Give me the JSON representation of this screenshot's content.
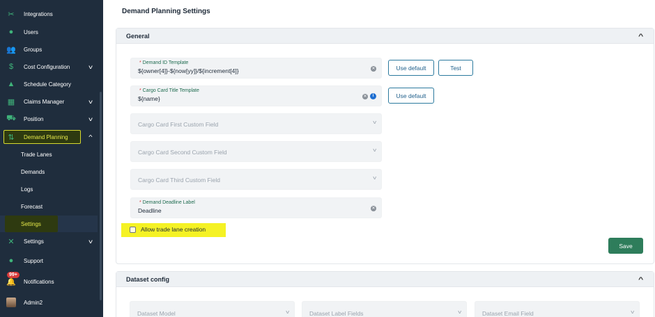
{
  "sidebar": {
    "items": [
      {
        "label": "Integrations",
        "icon": "integrations-icon"
      },
      {
        "label": "Users",
        "icon": "user-icon"
      },
      {
        "label": "Groups",
        "icon": "groups-icon"
      },
      {
        "label": "Cost Configuration",
        "icon": "dollar-icon"
      },
      {
        "label": "Schedule Category",
        "icon": "shapes-icon"
      },
      {
        "label": "Claims Manager",
        "icon": "claims-icon"
      },
      {
        "label": "Position",
        "icon": "cart-icon"
      },
      {
        "label": "Demand Planning",
        "icon": "demand-icon"
      },
      {
        "label": "Settings",
        "icon": "tools-icon"
      },
      {
        "label": "Support",
        "icon": "chat-icon"
      },
      {
        "label": "Notifications",
        "icon": "bell-icon"
      },
      {
        "label": "Admin2",
        "icon": "avatar"
      }
    ],
    "subitems": [
      "Trade Lanes",
      "Demands",
      "Logs",
      "Forecast",
      "Settings"
    ],
    "notification_badge": "99+"
  },
  "main": {
    "title": "Demand Planning Settings",
    "general": {
      "header": "General",
      "demand_id": {
        "label": "Demand ID Template",
        "value": "${owner[4]}-${now[yy]}/${increment[4]}"
      },
      "cargo_title": {
        "label": "Cargo Card Title Template",
        "value": "${name}"
      },
      "use_default": "Use default",
      "test": "Test",
      "custom1": "Cargo Card First Custom Field",
      "custom2": "Cargo Card Second Custom Field",
      "custom3": "Cargo Card Third Custom Field",
      "deadline": {
        "label": "Demand Deadline Label",
        "value": "Deadline"
      },
      "allow_trade_lane": "Allow trade lane creation",
      "save": "Save"
    },
    "dataset": {
      "header": "Dataset config",
      "model": "Dataset Model",
      "label_fields": "Dataset Label Fields",
      "email_field": "Dataset Email Field"
    }
  },
  "colors": {
    "sidebar": "#1f2d3d",
    "accent": "#2e7d5b",
    "highlight": "#f5f224"
  }
}
